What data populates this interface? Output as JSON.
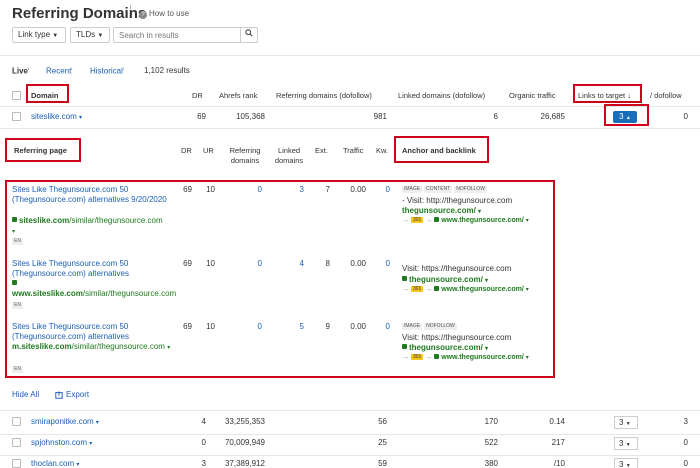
{
  "header": {
    "title": "Referring Domains",
    "info_mark": "i",
    "how_to_use": "How to use"
  },
  "filters": {
    "link_type": "Link type",
    "tlds": "TLDs",
    "search_placeholder": "Search in results"
  },
  "tabs": {
    "live": "Live",
    "recent": "Recent",
    "historical": "Historical",
    "results": "1,102 results"
  },
  "columns": {
    "domain": "Domain",
    "dr": "DR",
    "ahrefs_rank": "Ahrefs rank",
    "ref_domains": "Referring domains (dofollow)",
    "linked_domains": "Linked domains (dofollow)",
    "organic_traffic": "Organic traffic",
    "links_to_target": "Links to target",
    "dofollow": "/ dofollow"
  },
  "expanded_row": {
    "domain": "siteslike.com",
    "dr": "69",
    "ahrefs_rank": "105,368",
    "ref_domains": "981",
    "linked_domains": "6",
    "organic_traffic": "26,685",
    "links_to_target": "3",
    "dofollow": "0"
  },
  "sub_columns": {
    "referring_page": "Referring page",
    "dr": "DR",
    "ur": "UR",
    "ref_domains": "Referring domains",
    "linked_domains": "Linked domains",
    "ext": "Ext.",
    "traffic": "Traffic",
    "kw": "Kw.",
    "anchor": "Anchor and backlink"
  },
  "backlinks": [
    {
      "title": "Sites Like Thegunsource.com 50 (Thegunsource.com) alternatives 9/20/2020",
      "url_bold": "siteslike.com",
      "url_rest": "/similar/thegunsource.com",
      "lang": "EN",
      "dr": "69",
      "ur": "10",
      "ref": "0",
      "linked": "3",
      "ext": "7",
      "traffic": "0.00",
      "kw": "0",
      "tags": [
        "IMAGE",
        "CONTENT",
        "NOFOLLOW"
      ],
      "anchor": "- Visit: http://thegunsource.com",
      "target": "thegunsource.com/",
      "redirect_code": "301",
      "redirect_target": "www.thegunsource.com/"
    },
    {
      "title": "Sites Like Thegunsource.com 50 (Thegunsource.com) alternatives",
      "url_bold": "www.siteslike.com",
      "url_rest": "/similar/thegunsource.com",
      "lang": "EN",
      "dr": "69",
      "ur": "10",
      "ref": "0",
      "linked": "4",
      "ext": "8",
      "traffic": "0.00",
      "kw": "0",
      "tags": [],
      "anchor": "Visit: https://thegunsource.com",
      "target": "thegunsource.com/",
      "redirect_code": "301",
      "redirect_target": "www.thegunsource.com/"
    },
    {
      "title": "Sites Like Thegunsource.com 50 (Thegunsource.com) alternatives",
      "url_bold": "m.siteslike.com",
      "url_rest": "/similar/thegunsource.com",
      "lang": "EN",
      "dr": "69",
      "ur": "10",
      "ref": "0",
      "linked": "5",
      "ext": "9",
      "traffic": "0.00",
      "kw": "0",
      "tags": [
        "IMAGE",
        "NOFOLLOW"
      ],
      "anchor": "Visit: https://thegunsource.com",
      "target": "thegunsource.com/",
      "redirect_code": "301",
      "redirect_target": "www.thegunsource.com/"
    }
  ],
  "actions": {
    "hide_all": "Hide All",
    "export": "Export"
  },
  "rows": [
    {
      "domain": "smiraponitke.com",
      "dr": "4",
      "rank": "33,255,353",
      "ref": "56",
      "linked": "170",
      "traffic": "0.14",
      "links": "3",
      "dofollow": "3"
    },
    {
      "domain": "spjohnston.com",
      "dr": "0",
      "rank": "70,009,949",
      "ref": "25",
      "linked": "522",
      "traffic": "217",
      "links": "3",
      "dofollow": "0"
    },
    {
      "domain": "thoclan.com",
      "dr": "3",
      "rank": "37,389,912",
      "ref": "59",
      "linked": "380",
      "traffic": "/10",
      "links": "3",
      "dofollow": "0"
    }
  ],
  "colors": {
    "accent": "#1a5fb4",
    "highlight": "#d0021b",
    "url": "#1f7a1f"
  }
}
